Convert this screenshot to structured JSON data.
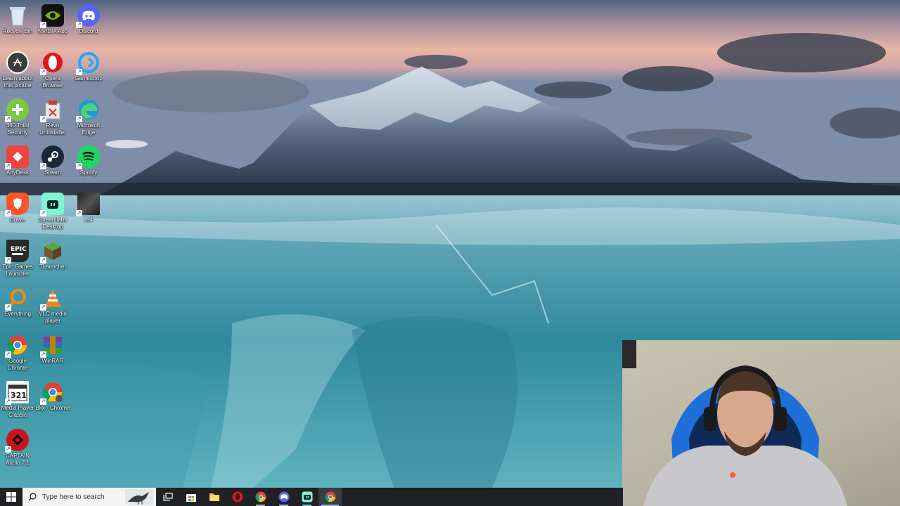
{
  "desktop": {
    "icons": [
      {
        "label": "Recycle Bin",
        "icon": "recycle-bin-icon"
      },
      {
        "label": "NVIDIA App",
        "icon": "nvidia-icon"
      },
      {
        "label": "Discord",
        "icon": "discord-icon"
      },
      {
        "label": "Learn about this picture",
        "icon": "camera-icon"
      },
      {
        "label": "Opera Browser",
        "icon": "opera-icon"
      },
      {
        "label": "GameLoop",
        "icon": "gameloop-icon"
      },
      {
        "label": "360 Total Security",
        "icon": "plus-shield-icon"
      },
      {
        "label": "Revo Uninstaller",
        "icon": "revo-icon"
      },
      {
        "label": "Microsoft Edge",
        "icon": "edge-icon"
      },
      {
        "label": "AnyDesk",
        "icon": "anydesk-icon"
      },
      {
        "label": "Steam",
        "icon": "steam-icon"
      },
      {
        "label": "Spotify",
        "icon": "spotify-icon"
      },
      {
        "label": "Brave",
        "icon": "brave-icon"
      },
      {
        "label": "Streamlabs Desktop",
        "icon": "streamlabs-icon"
      },
      {
        "label": "re4",
        "icon": "game-thumbnail-icon"
      },
      {
        "label": "Epic Games Launcher",
        "icon": "epic-games-icon"
      },
      {
        "label": "TLauncher",
        "icon": "grass-block-icon"
      },
      {
        "label": "Everything",
        "icon": "magnifier-icon"
      },
      {
        "label": "VLC media player",
        "icon": "vlc-cone-icon"
      },
      {
        "label": "Google Chrome",
        "icon": "chrome-icon"
      },
      {
        "label": "WinRAR",
        "icon": "winrar-icon"
      },
      {
        "label": "Media Player Classic",
        "icon": "mpc-icon"
      },
      {
        "label": "Bkx - Chrome",
        "icon": "chrome-icon"
      },
      {
        "label": "CAPTAIN Audio 7.1",
        "icon": "captain-audio-icon"
      }
    ]
  },
  "taskbar": {
    "search_placeholder": "Type here to search",
    "pinned": [
      {
        "name": "task-view",
        "icon": "task-view-icon"
      },
      {
        "name": "microsoft-store",
        "icon": "store-icon"
      },
      {
        "name": "file-explorer",
        "icon": "folder-icon"
      },
      {
        "name": "opera",
        "icon": "opera-icon"
      },
      {
        "name": "chrome",
        "icon": "chrome-icon"
      },
      {
        "name": "discord",
        "icon": "discord-icon"
      },
      {
        "name": "streamlabs",
        "icon": "streamlabs-icon"
      },
      {
        "name": "chrome-active",
        "icon": "chrome-icon"
      }
    ]
  },
  "colors": {
    "taskbar": "#1f2124",
    "accent": "#7ab8ff",
    "discord": "#5865f2",
    "opera": "#e0141e",
    "spotify": "#1ed760",
    "nvidia": "#76b900"
  }
}
